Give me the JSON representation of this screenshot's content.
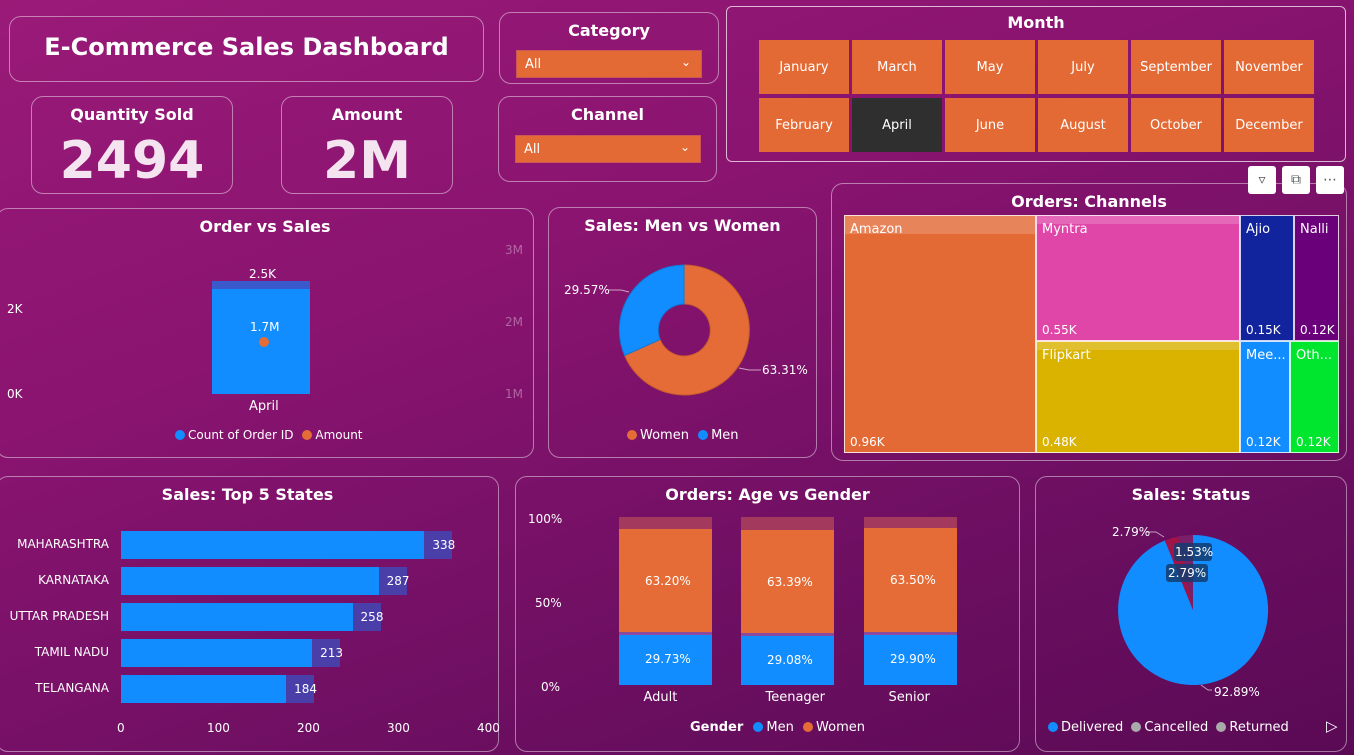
{
  "title": "E-Commerce Sales Dashboard",
  "kpis": {
    "quantity_label": "Quantity Sold",
    "quantity_value": "2494",
    "amount_label": "Amount",
    "amount_value": "2M"
  },
  "filters": {
    "category_label": "Category",
    "category_value": "All",
    "channel_label": "Channel",
    "channel_value": "All"
  },
  "month": {
    "label": "Month",
    "row1": [
      "January",
      "March",
      "May",
      "July",
      "September",
      "November"
    ],
    "row2": [
      "February",
      "April",
      "June",
      "August",
      "October",
      "December"
    ],
    "selected": "April"
  },
  "order_vs_sales": {
    "title": "Order vs Sales",
    "left_ticks": [
      "2K",
      "0K"
    ],
    "right_ticks": [
      "3M",
      "2M",
      "1M"
    ],
    "bar_top_label": "2.5K",
    "point_label": "1.7M",
    "category": "April",
    "legend": [
      "Count of Order ID",
      "Amount"
    ],
    "colors": {
      "orders": "#118dff",
      "amount": "#e66c37"
    }
  },
  "gender": {
    "title": "Sales: Men vs Women",
    "men_label": "29.57%",
    "women_label": "63.31%",
    "legend": [
      "Women",
      "Men"
    ]
  },
  "channels": {
    "title": "Orders: Channels",
    "items": [
      {
        "name": "Amazon",
        "value": "0.96K",
        "color": "#e36a35"
      },
      {
        "name": "Myntra",
        "value": "0.55K",
        "color": "#e046a8"
      },
      {
        "name": "Ajio",
        "value": "0.15K",
        "color": "#12239e"
      },
      {
        "name": "Nalli",
        "value": "0.12K",
        "color": "#6b007b"
      },
      {
        "name": "Flipkart",
        "value": "0.48K",
        "color": "#d9b300"
      },
      {
        "name": "Mee...",
        "value": "0.12K",
        "color": "#118dff"
      },
      {
        "name": "Oth...",
        "value": "0.12K",
        "color": "#00e62e"
      }
    ]
  },
  "states": {
    "title": "Sales: Top 5 States",
    "names": [
      "MAHARASHTRA",
      "KARNATAKA",
      "UTTAR PRADESH",
      "TAMIL NADU",
      "TELANGANA"
    ],
    "labels": [
      "338",
      "287",
      "258",
      "213",
      "184"
    ],
    "ticks": [
      "0",
      "100",
      "200",
      "300",
      "400"
    ]
  },
  "age_gender": {
    "title": "Orders: Age vs Gender",
    "y_ticks": [
      "100%",
      "50%",
      "0%"
    ],
    "groups": [
      "Adult",
      "Teenager",
      "Senior"
    ],
    "women_labels": [
      "63.20%",
      "63.39%",
      "63.50%"
    ],
    "men_labels": [
      "29.73%",
      "29.08%",
      "29.90%"
    ],
    "legend_title": "Gender",
    "legend": [
      "Men",
      "Women"
    ]
  },
  "status": {
    "title": "Sales: Status",
    "labels": [
      "2.79%",
      "1.53%",
      "2.79%",
      "92.89%"
    ],
    "legend": [
      "Delivered",
      "Cancelled",
      "Returned"
    ]
  },
  "chart_data": [
    {
      "type": "bar",
      "title": "Order vs Sales",
      "categories": [
        "April"
      ],
      "series": [
        {
          "name": "Count of Order ID",
          "values": [
            2500
          ]
        },
        {
          "name": "Amount",
          "values": [
            1700000
          ]
        }
      ]
    },
    {
      "type": "pie",
      "title": "Sales: Men vs Women",
      "categories": [
        "Women",
        "Men"
      ],
      "values": [
        63.31,
        29.57
      ]
    },
    {
      "type": "bar",
      "title": "Orders: Channels",
      "categories": [
        "Amazon",
        "Myntra",
        "Flipkart",
        "Ajio",
        "Nalli",
        "Mee...",
        "Oth..."
      ],
      "values": [
        960,
        550,
        480,
        150,
        120,
        120,
        120
      ]
    },
    {
      "type": "bar",
      "title": "Sales: Top 5 States",
      "categories": [
        "MAHARASHTRA",
        "KARNATAKA",
        "UTTAR PRADESH",
        "TAMIL NADU",
        "TELANGANA"
      ],
      "values": [
        338,
        287,
        258,
        213,
        184
      ],
      "xlim": [
        0,
        400
      ]
    },
    {
      "type": "bar",
      "title": "Orders: Age vs Gender",
      "categories": [
        "Adult",
        "Teenager",
        "Senior"
      ],
      "series": [
        {
          "name": "Men",
          "values": [
            29.73,
            29.08,
            29.9
          ]
        },
        {
          "name": "Women",
          "values": [
            63.2,
            63.39,
            63.5
          ]
        }
      ],
      "ylim": [
        0,
        100
      ]
    },
    {
      "type": "pie",
      "title": "Sales: Status",
      "categories": [
        "Delivered",
        "Cancelled",
        "Returned"
      ],
      "values": [
        92.89,
        2.79,
        2.79
      ]
    }
  ]
}
